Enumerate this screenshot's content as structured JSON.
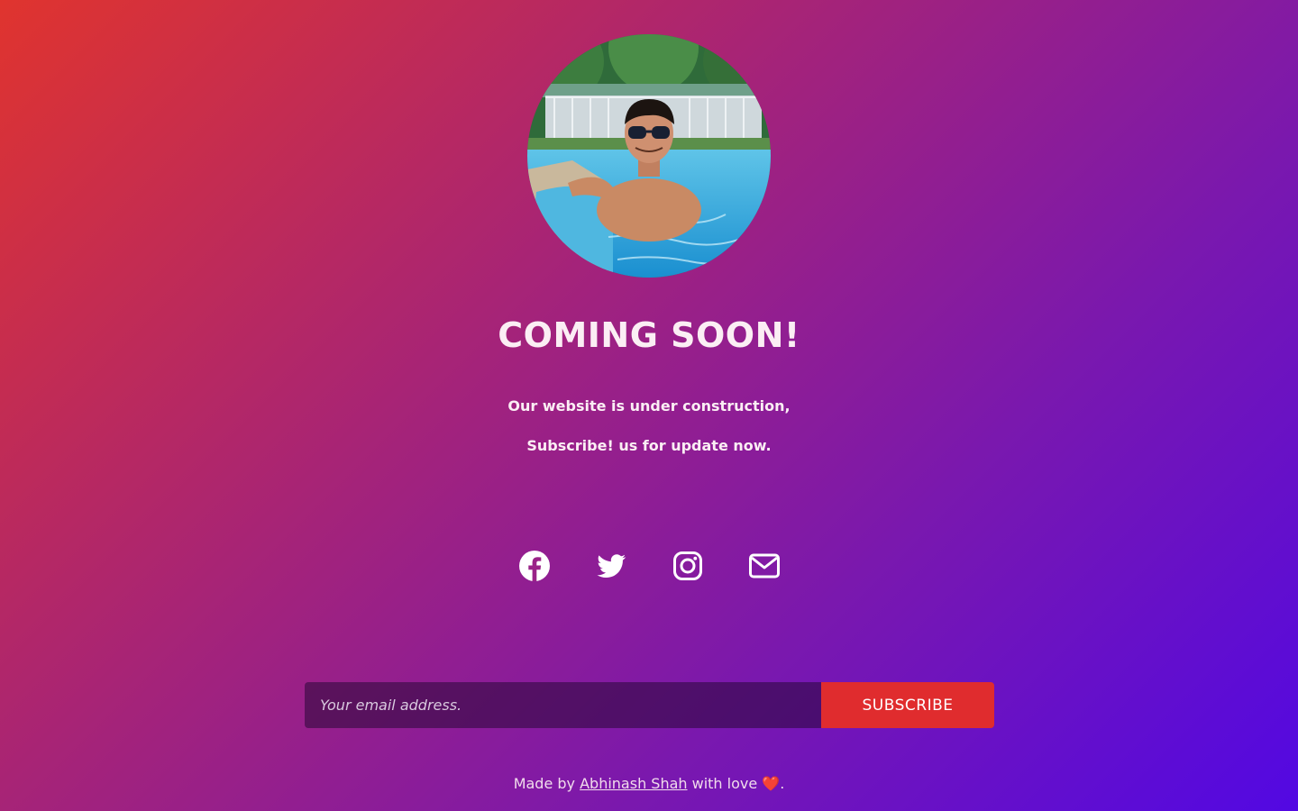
{
  "hero": {
    "title": "COMING SOON!",
    "line1": "Our website is under construction,",
    "line2": "Subscribe! us for update now."
  },
  "avatar": {
    "alt": "Profile photo"
  },
  "socials": [
    {
      "icon": "facebook-icon"
    },
    {
      "icon": "twitter-icon"
    },
    {
      "icon": "instagram-icon"
    },
    {
      "icon": "mail-icon"
    }
  ],
  "subscribe": {
    "placeholder": "Your email address.",
    "button_label": "SUBSCRIBE"
  },
  "footer": {
    "prefix": "Made by ",
    "author": "Abhinash Shah",
    "suffix": " with love ",
    "heart": "❤️",
    "end": "."
  },
  "colors": {
    "gradient_start": "#e0342e",
    "gradient_end": "#5208e3",
    "button": "#e02c2e"
  }
}
